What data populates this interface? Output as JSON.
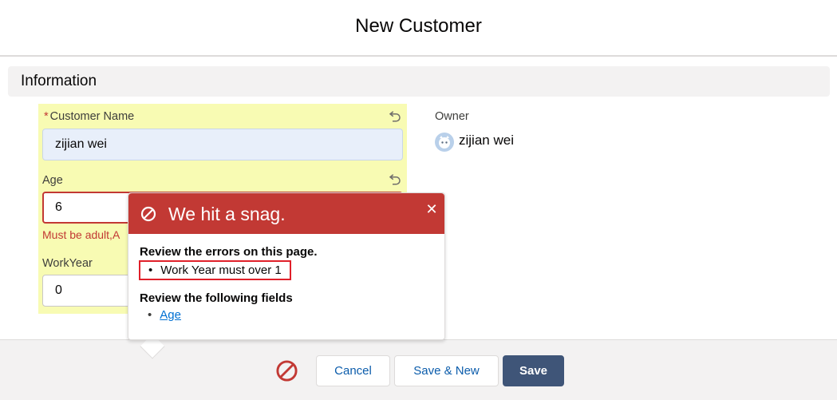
{
  "modal": {
    "title": "New Customer"
  },
  "section": {
    "title": "Information"
  },
  "fields": {
    "customer_name": {
      "label": "Customer Name",
      "required_mark": "*",
      "value": "zijian wei"
    },
    "age": {
      "label": "Age",
      "value": "6",
      "error": "Must be adult,A"
    },
    "work_year": {
      "label": "WorkYear",
      "value": "0"
    },
    "owner": {
      "label": "Owner",
      "name": "zijian wei"
    }
  },
  "popover": {
    "title": "We hit a snag.",
    "close_glyph": "✕",
    "errors_heading": "Review the errors on this page.",
    "errors": [
      "Work Year must over 1"
    ],
    "fields_heading": "Review the following fields",
    "fields": [
      "Age"
    ],
    "bullet": "•"
  },
  "footer": {
    "cancel_label": "Cancel",
    "save_new_label": "Save & New",
    "save_label": "Save"
  },
  "colors": {
    "error_red": "#c23934",
    "highlight_yellow": "#f8fbb3",
    "brand_button": "#3f5578",
    "link_blue": "#0070d2"
  },
  "icons": [
    "undo-icon",
    "error-icon",
    "close-icon",
    "avatar"
  ]
}
